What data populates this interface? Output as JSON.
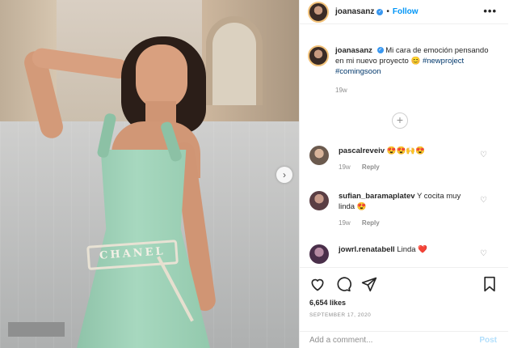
{
  "post": {
    "username": "joanasanz",
    "follow_label": "Follow",
    "more_glyph": "•••",
    "verified_glyph": "✓",
    "dot": "•",
    "photo_text": "CHANEL",
    "caption": {
      "username": "joanasanz",
      "text": "Mi cara de emoción pensando en mi nuevo proyecto 😊",
      "hashtags": "#newproject #comingsoon",
      "time": "19w"
    },
    "load_more_glyph": "+",
    "comments": [
      {
        "username": "pascalreveiv",
        "text": "😍😍🙌😍",
        "time": "19w",
        "reply_label": "Reply"
      },
      {
        "username": "sufian_baramaplatev",
        "text": "Y cocita muy linda 😍",
        "time": "19w",
        "reply_label": "Reply"
      },
      {
        "username": "jowrl.renatabell",
        "text": "Linda ❤️",
        "time": "",
        "reply_label": ""
      }
    ],
    "likes": "6,654 likes",
    "date": "SEPTEMBER 17, 2020",
    "add_comment_placeholder": "Add a comment...",
    "post_label": "Post"
  },
  "colors": {
    "link_blue": "#0095f6",
    "post_disabled": "#b2dffc",
    "muted": "#8e8e8e",
    "dress": "#a7d8bf"
  },
  "icons": [
    "chevron-right-icon",
    "more-icon",
    "verified-icon",
    "plus-circle-icon",
    "heart-icon",
    "comment-icon",
    "share-icon",
    "bookmark-icon"
  ]
}
